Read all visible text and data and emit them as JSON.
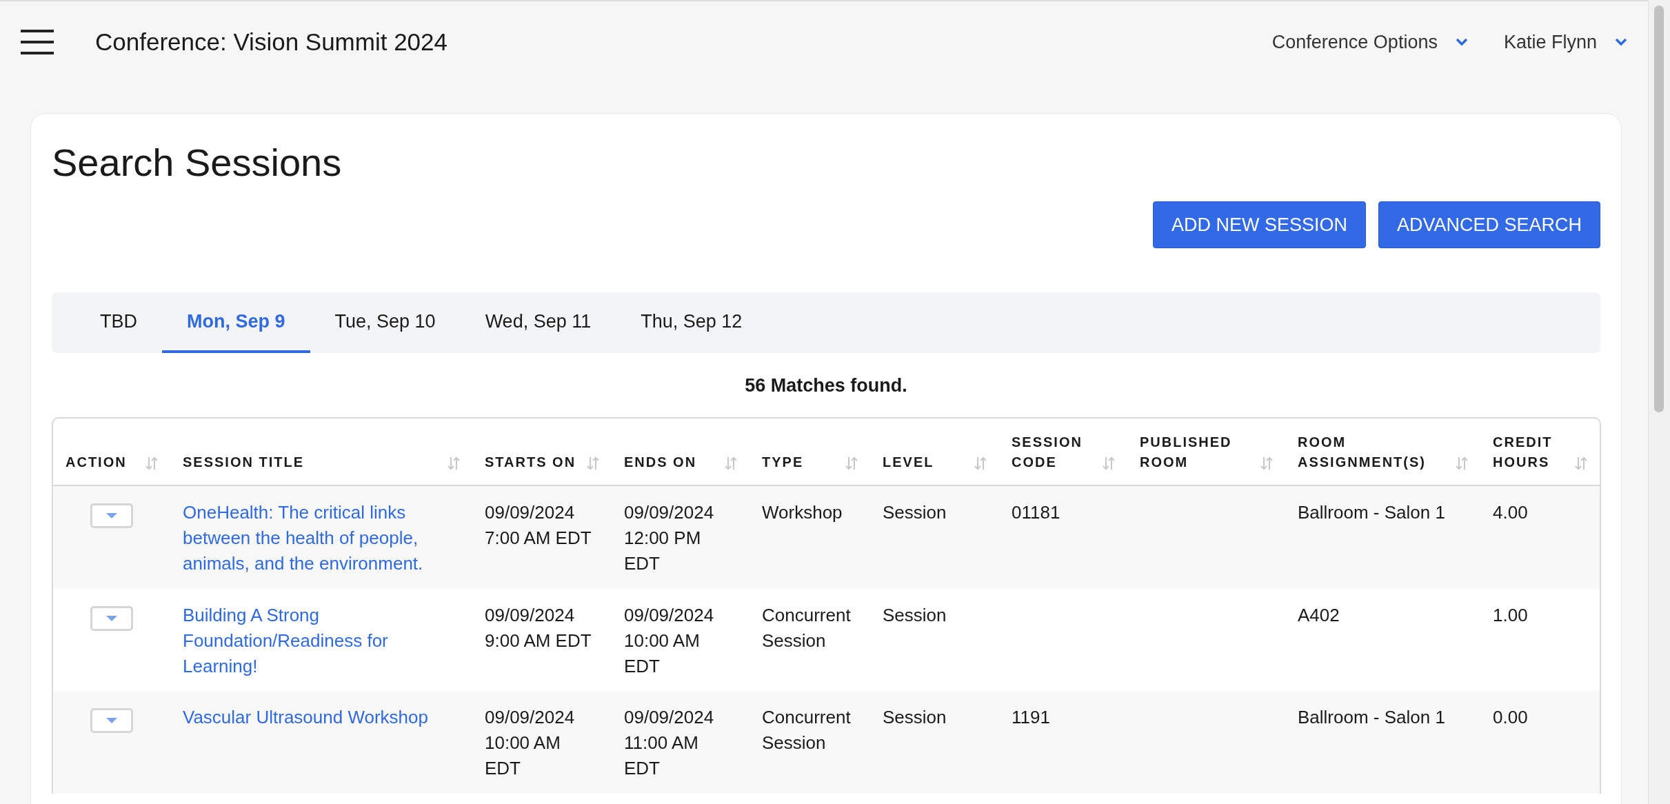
{
  "header": {
    "title": "Conference: Vision Summit 2024",
    "menus": [
      {
        "label": "Conference Options"
      },
      {
        "label": "Katie Flynn"
      }
    ]
  },
  "page": {
    "title": "Search Sessions",
    "buttons": [
      "ADD NEW SESSION",
      "ADVANCED SEARCH"
    ]
  },
  "tabs": [
    {
      "label": "TBD",
      "selected": false
    },
    {
      "label": "Mon, Sep 9",
      "selected": true
    },
    {
      "label": "Tue, Sep 10",
      "selected": false
    },
    {
      "label": "Wed, Sep 11",
      "selected": false
    },
    {
      "label": "Thu, Sep 12",
      "selected": false
    }
  ],
  "match_count": "56 Matches found.",
  "table": {
    "columns": [
      {
        "label": "ACTION"
      },
      {
        "label": "SESSION TITLE"
      },
      {
        "label": "STARTS ON"
      },
      {
        "label": "ENDS ON"
      },
      {
        "label": "TYPE"
      },
      {
        "label": "LEVEL"
      },
      {
        "label": "SESSION CODE"
      },
      {
        "label": "PUBLISHED ROOM"
      },
      {
        "label": "ROOM ASSIGNMENT(S)"
      },
      {
        "label": "CREDIT HOURS"
      }
    ],
    "rows": [
      {
        "title": "OneHealth: The critical links between the health of people, animals, and the environment.",
        "starts_on": "09/09/2024 7:00 AM EDT",
        "ends_on": "09/09/2024 12:00 PM EDT",
        "type": "Workshop",
        "level": "Session",
        "session_code": "01181",
        "room_assignments": "Ballroom - Salon 1",
        "credit_hours": "4.00"
      },
      {
        "title": "Building A Strong Foundation/Readiness for Learning!",
        "starts_on": "09/09/2024 9:00 AM EDT",
        "ends_on": "09/09/2024 10:00 AM EDT",
        "type": "Concurrent Session",
        "level": "Session",
        "room_assignments": "A402",
        "credit_hours": "1.00"
      },
      {
        "title": "Vascular Ultrasound Workshop",
        "starts_on": "09/09/2024 10:00 AM EDT",
        "ends_on": "09/09/2024 11:00 AM EDT",
        "type": "Concurrent Session",
        "level": "Session",
        "session_code": "1191",
        "room_assignments": "Ballroom - Salon 1",
        "credit_hours": "0.00"
      }
    ]
  }
}
